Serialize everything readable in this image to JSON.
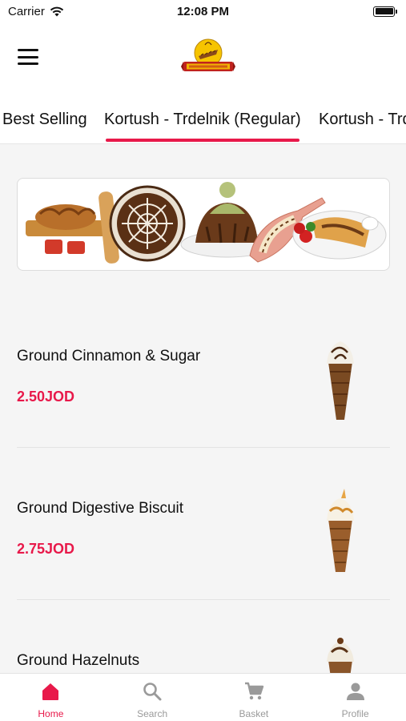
{
  "status_bar": {
    "carrier": "Carrier",
    "time": "12:08 PM",
    "battery_level": 1.0
  },
  "header": {
    "menu_icon": "hamburger-menu-icon",
    "logo_text": "CHIMNEY ROLL",
    "logo_colors": {
      "primary": "#f6c400",
      "accent": "#c0231e"
    }
  },
  "tabs": [
    {
      "label": "Best Selling",
      "active": false
    },
    {
      "label": "Kortush - Trdelnik (Regular)",
      "active": true
    },
    {
      "label": "Kortush - Trdelnik (Chocolate)",
      "active": false
    }
  ],
  "banner": {
    "image": "desserts-banner"
  },
  "products": [
    {
      "name": "Ground Cinnamon & Sugar",
      "price": "2.50JOD",
      "image": "chimney-cone-chocolate"
    },
    {
      "name": "Ground Digestive Biscuit",
      "price": "2.75JOD",
      "image": "chimney-cone-caramel"
    },
    {
      "name": "Ground Hazelnuts",
      "price": "",
      "image": "chimney-cone-hazelnut"
    }
  ],
  "bottom_nav": [
    {
      "label": "Home",
      "icon": "home-icon",
      "active": true
    },
    {
      "label": "Search",
      "icon": "search-icon",
      "active": false
    },
    {
      "label": "Basket",
      "icon": "cart-icon",
      "active": false
    },
    {
      "label": "Profile",
      "icon": "profile-icon",
      "active": false
    }
  ],
  "colors": {
    "accent": "#e8194a",
    "inactive": "#9a9a9a",
    "background": "#f5f5f5"
  }
}
